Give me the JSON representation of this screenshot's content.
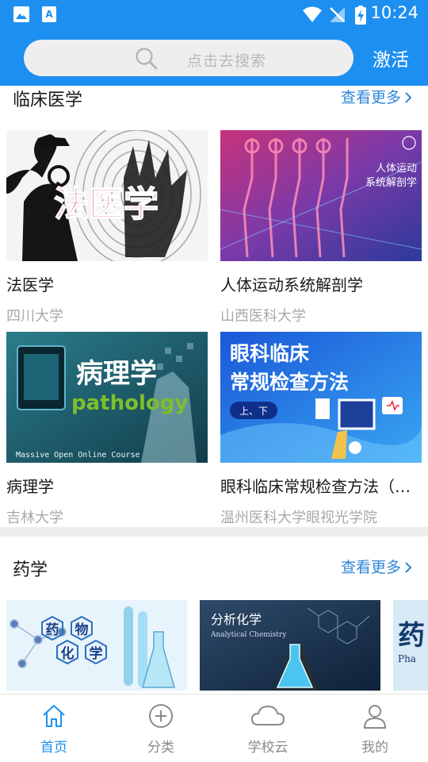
{
  "status_bar": {
    "time": "10:24"
  },
  "header": {
    "search_placeholder": "点击去搜索",
    "activate_label": "激活"
  },
  "sections": [
    {
      "title": "临床医学",
      "more_label": "查看更多",
      "courses": [
        {
          "title": "法医学",
          "school": "四川大学",
          "cover_text": "法医学"
        },
        {
          "title": "人体运动系统解剖学",
          "school": "山西医科大学",
          "cover_text": "人体运动\n系统解剖学"
        },
        {
          "title": "病理学",
          "school": "吉林大学",
          "cover_text": "病理学",
          "cover_text_en": "pathology",
          "cover_caption": "Massive Open Online Course"
        },
        {
          "title": "眼科临床常规检查方法（…",
          "school": "温州医科大学眼视光学院",
          "cover_text": "眼科临床\n常规检查方法",
          "cover_tag": "上、下"
        }
      ]
    },
    {
      "title": "药学",
      "more_label": "查看更多",
      "courses": [
        {
          "cover_text": "药物化学"
        },
        {
          "cover_text": "分析化学",
          "cover_text_en": "Analytical Chemistry"
        },
        {
          "cover_text": "药"
        }
      ]
    }
  ],
  "tabbar": {
    "tabs": [
      {
        "label": "首页",
        "icon": "home-icon",
        "active": true
      },
      {
        "label": "分类",
        "icon": "plus-circle-icon",
        "active": false
      },
      {
        "label": "学校云",
        "icon": "cloud-icon",
        "active": false
      },
      {
        "label": "我的",
        "icon": "person-icon",
        "active": false
      }
    ]
  },
  "colors": {
    "primary": "#1d8ff0",
    "link": "#2f86d6",
    "muted": "#a9a9a9"
  }
}
